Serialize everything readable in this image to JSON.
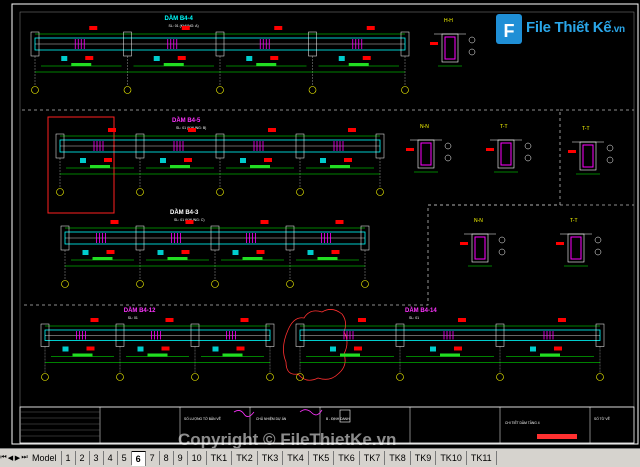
{
  "drawing": {
    "beams": [
      {
        "label": "DẦM B4-4",
        "sub": "SL: 01 (KHUNG: A)",
        "color": "#00ffff"
      },
      {
        "label": "DẦM B4-5",
        "sub": "SL: 01 (KHUNG: B)",
        "color": "#ff33ff"
      },
      {
        "label": "DẦM B4-3",
        "sub": "SL: 01 (KHUNG: C)",
        "color": "#ffffff"
      },
      {
        "label": "DẦM B4-12",
        "sub": "SL: 01",
        "color": "#ff33ff"
      },
      {
        "label": "DẦM B4-14",
        "sub": "SL: 01",
        "color": "#ff33ff"
      }
    ],
    "sections": [
      "H-H",
      "N-N",
      "T-T",
      "T-T",
      "N-N",
      "T-T"
    ],
    "axis_labels": [
      "1",
      "2",
      "3"
    ]
  },
  "title_block": {
    "col1": "SỐ LƯỢNG TỜ BẢN VẼ",
    "col2": "CHỦ NHIỆM DỰ ÁN",
    "col3": "B - ĐỊNH DANH",
    "col4": "CHI TIẾT DẦM TẦNG 4",
    "col5": "SỐ TỜ VẼ"
  },
  "logo": {
    "brand": "File Thiết Kế",
    "tld": ".vn"
  },
  "watermark": "Copyright © FileThietKe.vn",
  "tabs": [
    "Model",
    "1",
    "2",
    "3",
    "4",
    "5",
    "6",
    "7",
    "8",
    "9",
    "10",
    "TK1",
    "TK2",
    "TK3",
    "TK4",
    "TK5",
    "TK6",
    "TK7",
    "TK8",
    "TK9",
    "TK10",
    "TK11"
  ],
  "active_tab": "6",
  "colors": {
    "beam": "#00ffff",
    "rebar": "#ff00ff",
    "dim": "#00ff00",
    "label": "#ff0000",
    "section": "#ffff00"
  }
}
